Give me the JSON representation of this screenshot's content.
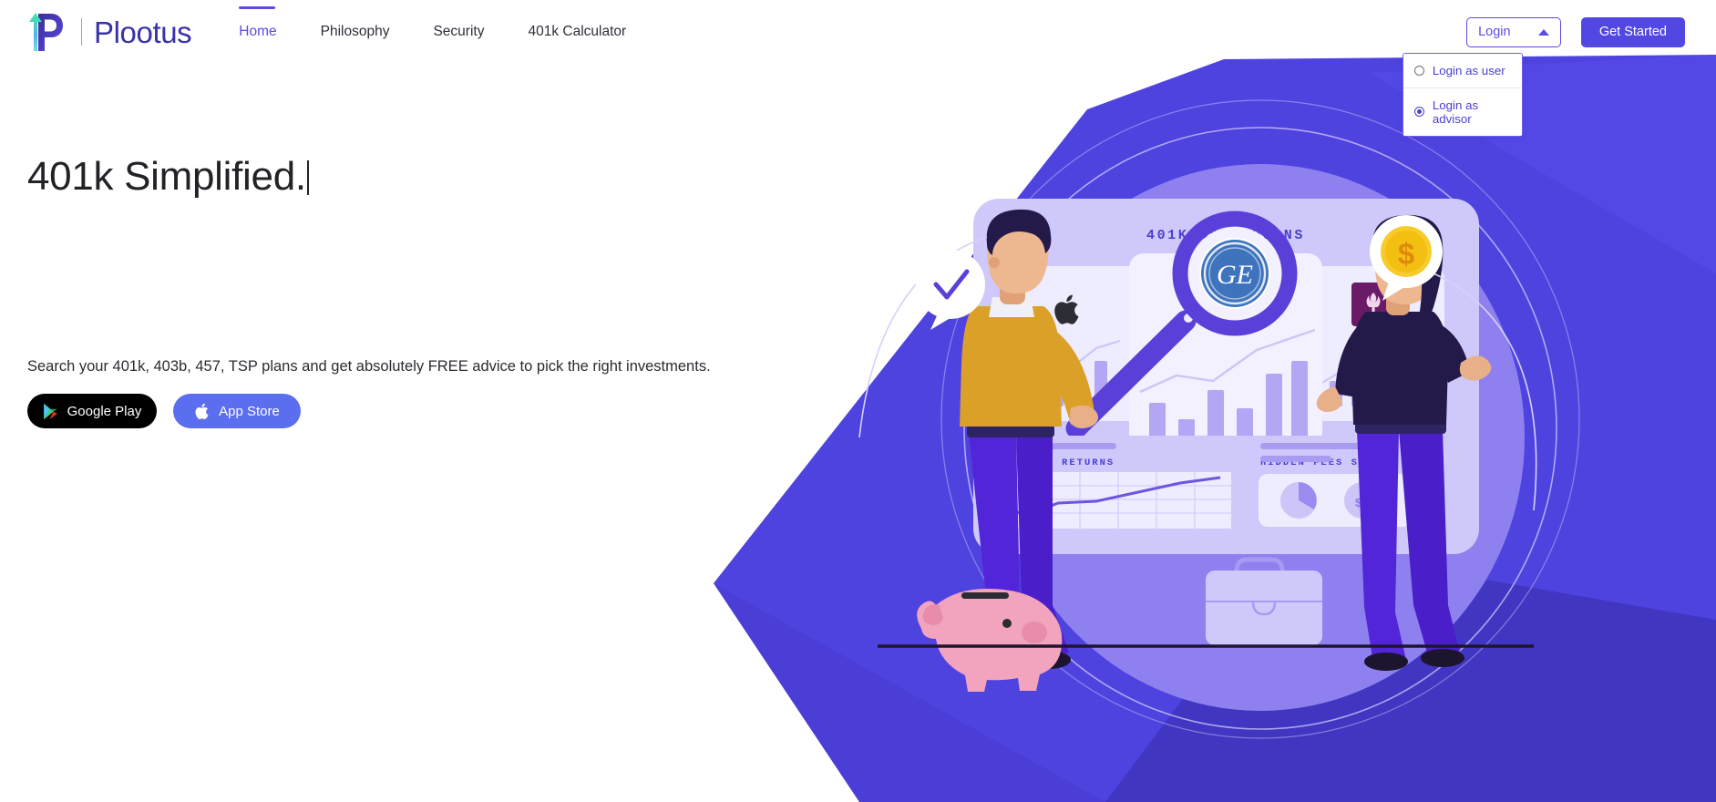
{
  "brand": {
    "logo_icon": "plootus-p-arrow-logo",
    "name": "Plootus"
  },
  "nav": {
    "links": [
      {
        "label": "Home",
        "active": true
      },
      {
        "label": "Philosophy",
        "active": false
      },
      {
        "label": "Security",
        "active": false
      },
      {
        "label": "401k Calculator",
        "active": false
      }
    ],
    "login": {
      "label": "Login",
      "caret_icon": "chevron-up-icon",
      "expanded": true,
      "options": [
        {
          "label": "Login as user",
          "selected": false
        },
        {
          "label": "Login as advisor",
          "selected": true
        }
      ]
    },
    "get_started_label": "Get Started"
  },
  "hero": {
    "title": "401k Simplified.",
    "subtitle": "Search your 401k, 403b, 457, TSP plans and get absolutely FREE advice to pick the right investments.",
    "store_buttons": [
      {
        "label": "Google Play",
        "icon": "google-play-icon"
      },
      {
        "label": "App Store",
        "icon": "apple-icon"
      }
    ]
  },
  "illustration": {
    "heading": "401K/403B PLANS",
    "panel_labels": [
      "BETTER RETURNS",
      "HIDDEN FEES SAVED"
    ],
    "brand_cards": [
      "apple-logo-card",
      "ge-logo-card",
      "nyu-logo-card"
    ],
    "nyu_text": "NYU",
    "ge_text": "GE",
    "dollar_symbol": "$",
    "elements": [
      "magnifying-glass",
      "checkmark-speech-bubble",
      "dollar-coin-speech-bubble",
      "piggy-bank",
      "briefcase",
      "man-character",
      "woman-character"
    ]
  },
  "colors": {
    "accent": "#5247e0",
    "accent_light": "#6f5fe8",
    "brand_text": "#3a33a8",
    "hero_bg": "#4f43e0",
    "hero_bg_dark": "#3f35bf",
    "card_light": "#d5d2fb",
    "bar_purple": "#a99bf2",
    "gold": "#d99a25",
    "pink": "#f2a3bd",
    "navy": "#241a4a"
  }
}
